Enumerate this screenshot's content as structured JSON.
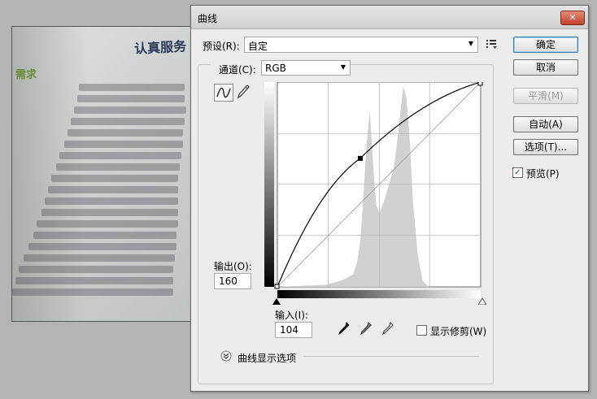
{
  "photo": {
    "heading": "认真服务",
    "side": "需求"
  },
  "dialog": {
    "title": "曲线",
    "close": "✕",
    "preset": {
      "label": "预设(R):",
      "value": "自定"
    },
    "channel": {
      "label": "通道(C):",
      "value": "RGB"
    },
    "output": {
      "label": "输出(O):",
      "value": "160"
    },
    "input": {
      "label": "输入(I):",
      "value": "104"
    },
    "show_clipping": {
      "label": "显示修剪(W)",
      "checked": false
    },
    "curve_display": {
      "label": "曲线显示选项"
    },
    "buttons": {
      "ok": "确定",
      "cancel": "取消",
      "smooth": "平滑(M)",
      "auto": "自动(A)",
      "options": "选项(T)..."
    },
    "preview": {
      "label": "预览(P)",
      "checked": true
    },
    "colors": {
      "accent": "#3d7bad",
      "histogram": "#d0d0d0"
    },
    "icons": {
      "preset_menu": "list-menu-icon",
      "curve_tool": "curve-tool-icon",
      "pencil_tool": "pencil-icon",
      "black_point": "eyedropper-black-icon",
      "gray_point": "eyedropper-gray-icon",
      "white_point": "eyedropper-white-icon",
      "expand": "chevron-down-circle-icon"
    }
  }
}
